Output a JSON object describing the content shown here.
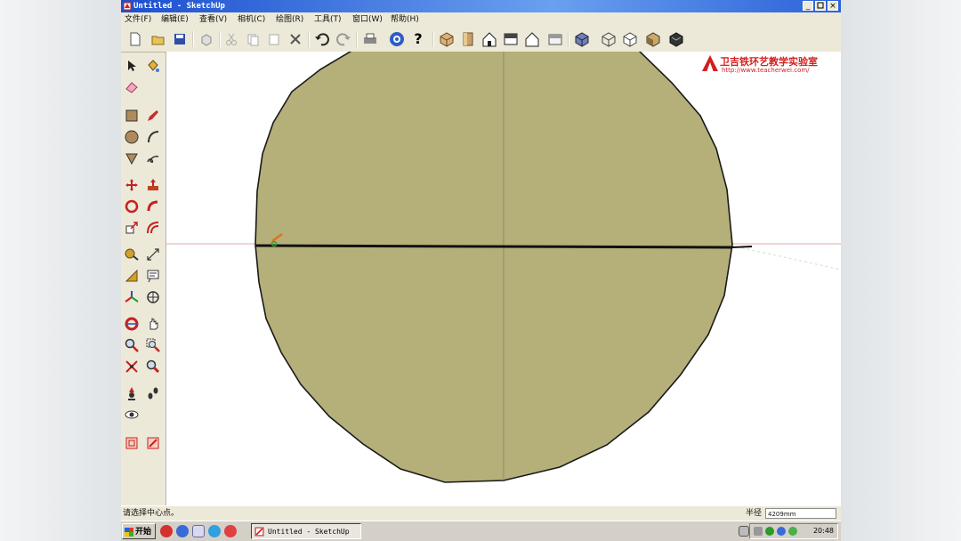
{
  "window": {
    "title": "Untitled - SketchUp",
    "minimize": "_",
    "close": "×"
  },
  "menu": [
    {
      "label": "文件(F)"
    },
    {
      "label": "编辑(E)"
    },
    {
      "label": "查看(V)"
    },
    {
      "label": "相机(C)"
    },
    {
      "label": "绘图(R)"
    },
    {
      "label": "工具(T)"
    },
    {
      "label": "窗口(W)"
    },
    {
      "label": "帮助(H)"
    }
  ],
  "toolbar": {
    "help_glyph": "?"
  },
  "watermark": {
    "title": "卫吉铁环艺教学实验室",
    "url": "http://www.teacherwei.com/"
  },
  "status": {
    "message": "请选择中心点。",
    "vcc_label": "半径",
    "vcc_value": "4209mm"
  },
  "taskbar": {
    "start": "开始",
    "task_item": "Untitled - SketchUp",
    "clock": "20:48"
  },
  "colors": {
    "face": "#b5b07a",
    "edge": "#1a1a1a",
    "red_axis": "#e08080",
    "green_axis": "#7fbf7f",
    "title_bar": "#1c4fcf"
  }
}
